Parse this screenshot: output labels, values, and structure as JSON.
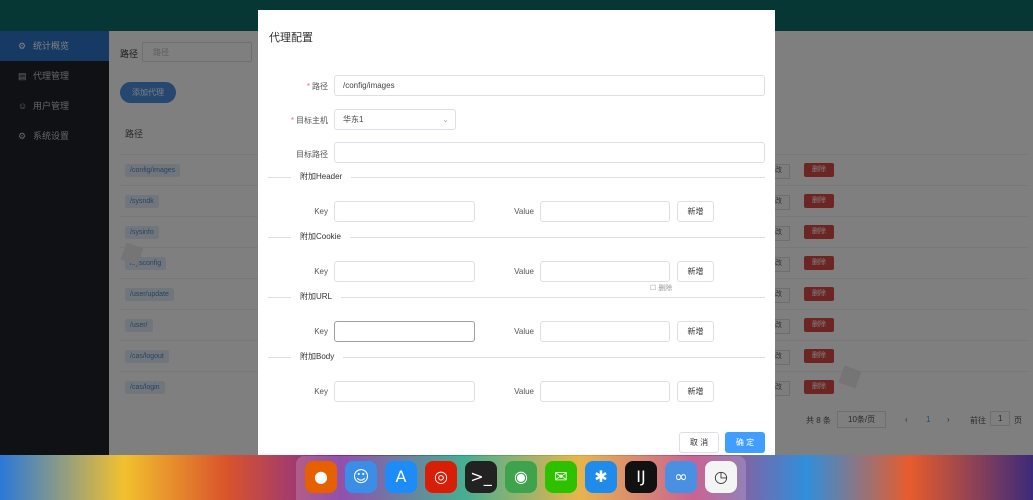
{
  "sidebar": {
    "items": [
      {
        "label": "统计概览",
        "icon": "gear-icon",
        "glyph": "⚙",
        "active": true
      },
      {
        "label": "代理管理",
        "icon": "document-icon",
        "glyph": "▤",
        "active": false
      },
      {
        "label": "用户管理",
        "icon": "user-icon",
        "glyph": "☺",
        "active": false
      },
      {
        "label": "系统设置",
        "icon": "gear-icon",
        "glyph": "⚙",
        "active": false
      }
    ]
  },
  "main": {
    "filter_label": "路径",
    "filter_placeholder": "路径",
    "add_button": "添加代理",
    "column_path": "路径",
    "rows": [
      {
        "path": "/config/images",
        "delete": "删除"
      },
      {
        "path": "/sysndk",
        "delete": "删除"
      },
      {
        "path": "/sysinfo",
        "delete": "删除"
      },
      {
        "path": "/sysconfig",
        "delete": "删除"
      },
      {
        "path": "/user/update",
        "delete": "删除"
      },
      {
        "path": "/user/",
        "delete": "删除"
      },
      {
        "path": "/cas/logout",
        "delete": "删除"
      },
      {
        "path": "/cas/login",
        "delete": "删除"
      }
    ],
    "edit_fragment": "改",
    "pager": {
      "total": "共 8 条",
      "page_size": "10条/页",
      "prev": "‹",
      "current": "1",
      "next": "›",
      "goto_label": "前往",
      "goto_value": "1",
      "page_unit": "页"
    }
  },
  "dialog": {
    "title": "代理配置",
    "path_label": "路径",
    "path_value": "/config/images",
    "host_label": "目标主机",
    "host_value": "华东1",
    "target_path_label": "目标路径",
    "target_path_value": "",
    "sections": [
      {
        "title": "附加Header",
        "key_label": "Key",
        "value_label": "Value",
        "add_button": "新增"
      },
      {
        "title": "附加Cookie",
        "key_label": "Key",
        "value_label": "Value",
        "add_button": "新增"
      },
      {
        "title": "附加URL",
        "key_label": "Key",
        "value_label": "Value",
        "add_button": "新增"
      },
      {
        "title": "附加Body",
        "key_label": "Key",
        "value_label": "Value",
        "add_button": "新增"
      }
    ],
    "hint": "☐ 删除",
    "cancel": "取 消",
    "confirm": "确 定"
  },
  "dock": {
    "apps": [
      {
        "name": "firefox-icon",
        "glyph": "●",
        "color": "#e66000"
      },
      {
        "name": "finder-icon",
        "glyph": "☺",
        "color": "#3a8ee6"
      },
      {
        "name": "app-store-icon",
        "glyph": "A",
        "color": "#1d8cf8"
      },
      {
        "name": "netease-music-icon",
        "glyph": "◎",
        "color": "#d81e06"
      },
      {
        "name": "terminal-icon",
        "glyph": ">_",
        "color": "#222222"
      },
      {
        "name": "chrome-icon",
        "glyph": "◉",
        "color": "#3fa34d"
      },
      {
        "name": "wechat-icon",
        "glyph": "✉",
        "color": "#2dc100"
      },
      {
        "name": "xmind-icon",
        "glyph": "✱",
        "color": "#1f8ceb"
      },
      {
        "name": "intellij-icon",
        "glyph": "IJ",
        "color": "#111111"
      },
      {
        "name": "baidu-netdisk-icon",
        "glyph": "∞",
        "color": "#4a90e2"
      },
      {
        "name": "clock-icon",
        "glyph": "◷",
        "color": "#f4f4f4"
      }
    ]
  }
}
